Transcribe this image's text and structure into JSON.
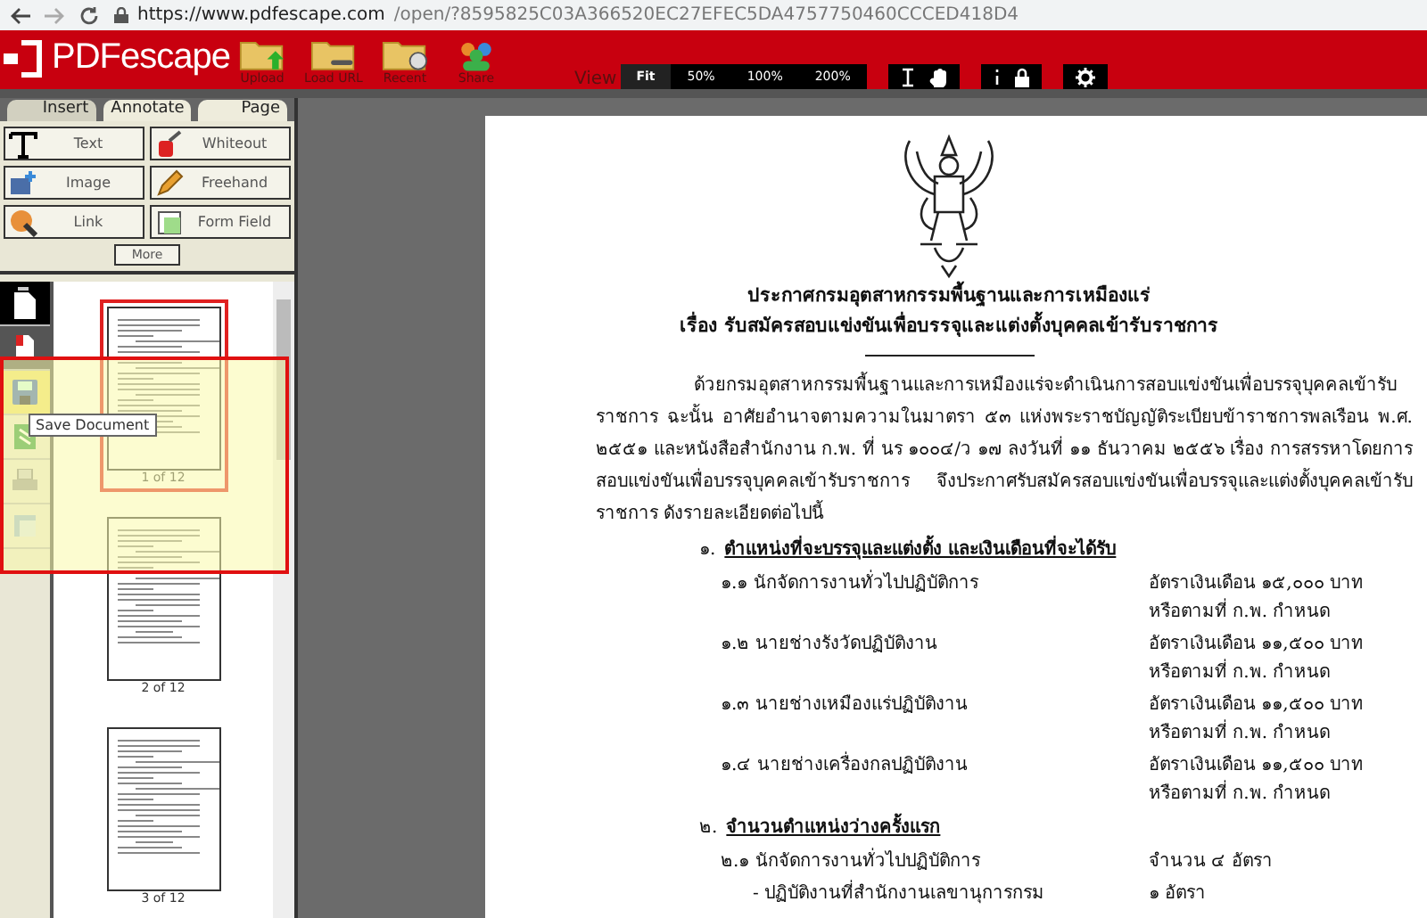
{
  "address_bar": {
    "host": "https://www.pdfescape.com",
    "path": "/open/?8595825C03A366520EC27EFEC5DA4757750460CCCED418D4"
  },
  "header": {
    "logo": "PDFescape",
    "actions": [
      {
        "label": "Upload",
        "kind": "upload"
      },
      {
        "label": "Load URL",
        "kind": "link"
      },
      {
        "label": "Recent",
        "kind": "recent"
      },
      {
        "label": "Share",
        "kind": "share"
      }
    ],
    "view_label": "View",
    "zoom_options": [
      {
        "label": "Fit",
        "selected": true
      },
      {
        "label": "50%",
        "selected": false
      },
      {
        "label": "100%",
        "selected": false
      },
      {
        "label": "200%",
        "selected": false
      }
    ]
  },
  "panel_tabs": [
    {
      "label": "Insert",
      "selected": true
    },
    {
      "label": "Annotate",
      "selected": false
    },
    {
      "label": "Page",
      "selected": false
    }
  ],
  "tools": [
    {
      "label": "Text",
      "kind": "text"
    },
    {
      "label": "Whiteout",
      "kind": "whiteout"
    },
    {
      "label": "Image",
      "kind": "image"
    },
    {
      "label": "Freehand",
      "kind": "freehand"
    },
    {
      "label": "Link",
      "kind": "link"
    },
    {
      "label": "Form Field",
      "kind": "field"
    }
  ],
  "more_button": "More",
  "tooltip": "Save Document",
  "thumbnails": [
    {
      "label": "1 of 12",
      "selected": true
    },
    {
      "label": "2 of 12",
      "selected": false
    },
    {
      "label": "3 of 12",
      "selected": false
    }
  ],
  "document": {
    "title_lines": [
      "ประกาศกรมอุตสาหกรรมพื้นฐานและการเหมืองแร่",
      "เรื่อง รับสมัครสอบแข่งขันเพื่อบรรจุและแต่งตั้งบุคคลเข้ารับราชการ"
    ],
    "paragraph": "ด้วยกรมอุตสาหกรรมพื้นฐานและการเหมืองแร่จะดำเนินการสอบแข่งขันเพื่อบรรจุบุคคลเข้ารับราชการ ฉะนั้น อาศัยอำนาจตามความในมาตรา ๕๓ แห่งพระราชบัญญัติระเบียบข้าราชการพลเรือน พ.ศ. ๒๕๕๑ และหนังสือสำนักงาน ก.พ. ที่ นร ๑๐๐๔/ว ๑๗ ลงวันที่ ๑๑ ธันวาคม ๒๕๕๖ เรื่อง การสรรหาโดยการสอบแข่งขันเพื่อบรรจุบุคคลเข้ารับราชการ จึงประกาศรับสมัครสอบแข่งขันเพื่อบรรจุและแต่งตั้งบุคคลเข้ารับราชการ ดังรายละเอียดต่อไปนี้",
    "sections": [
      {
        "number": "๑.",
        "heading": "ตำแหน่งที่จะบรรจุและแต่งตั้ง และเงินเดือนที่จะได้รับ",
        "items": [
          {
            "label": "๑.๑ นักจัดการงานทั่วไปปฏิบัติการ",
            "value_lines": [
              "อัตราเงินเดือน ๑๕,๐๐๐ บาท",
              "หรือตามที่ ก.พ. กำหนด"
            ]
          },
          {
            "label": "๑.๒ นายช่างรังวัดปฏิบัติงาน",
            "value_lines": [
              "อัตราเงินเดือน ๑๑,๕๐๐ บาท",
              "หรือตามที่ ก.พ. กำหนด"
            ]
          },
          {
            "label": "๑.๓ นายช่างเหมืองแร่ปฏิบัติงาน",
            "value_lines": [
              "อัตราเงินเดือน ๑๑,๕๐๐ บาท",
              "หรือตามที่ ก.พ. กำหนด"
            ]
          },
          {
            "label": "๑.๔ นายช่างเครื่องกลปฏิบัติงาน",
            "value_lines": [
              "อัตราเงินเดือน ๑๑,๕๐๐ บาท",
              "หรือตามที่ ก.พ. กำหนด"
            ]
          }
        ]
      },
      {
        "number": "๒.",
        "heading": "จำนวนตำแหน่งว่างครั้งแรก",
        "items": [
          {
            "label": "๒.๑ นักจัดการงานทั่วไปปฏิบัติการ",
            "value_lines": [
              "จำนวน ๔ อัตรา"
            ],
            "children": [
              {
                "label": "- ปฏิบัติงานที่สำนักงานเลขานุการกรม",
                "value_lines": [
                  "๑ อัตรา"
                ]
              }
            ]
          }
        ]
      }
    ]
  }
}
